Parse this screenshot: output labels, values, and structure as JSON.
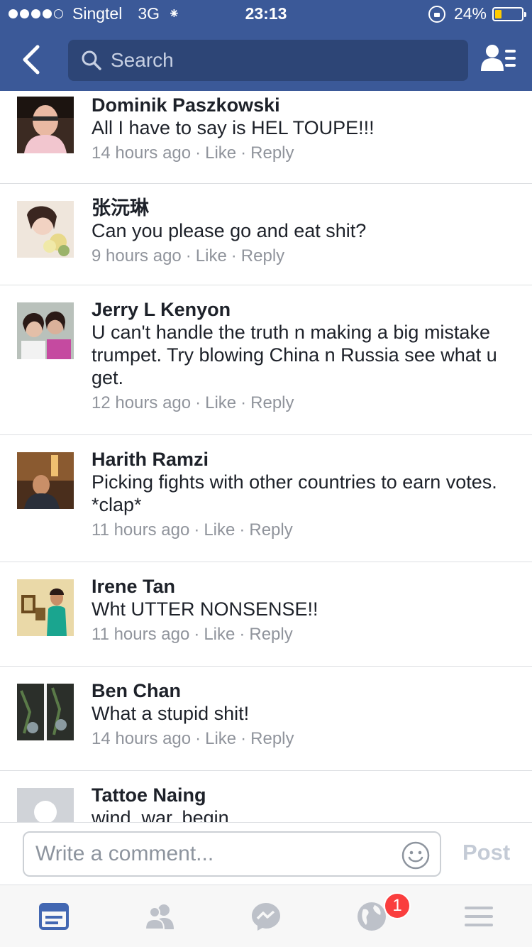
{
  "status_bar": {
    "carrier": "Singtel",
    "network": "3G",
    "time": "23:13",
    "battery": "24%",
    "battery_level": 0.24,
    "signal_bars": 4
  },
  "nav": {
    "search_placeholder": "Search"
  },
  "comments": [
    {
      "name": "Dominik Paszkowski",
      "text": "All I have to say is HEL TOUPE!!!",
      "time": "14 hours ago",
      "like": "Like",
      "reply": "Reply"
    },
    {
      "name": "张沅琳",
      "text": "Can you please go and eat shit?",
      "time": "9 hours ago",
      "like": "Like",
      "reply": "Reply"
    },
    {
      "name": "Jerry L Kenyon",
      "text": "U can't handle the truth n making a big mistake trumpet.  Try blowing China n Russia see what u get.",
      "time": "12 hours ago",
      "like": "Like",
      "reply": "Reply"
    },
    {
      "name": "Harith Ramzi",
      "text": "Picking fights with other countries to earn votes. *clap*",
      "time": "11 hours ago",
      "like": "Like",
      "reply": "Reply"
    },
    {
      "name": "Irene Tan",
      "text": "Wht UTTER NONSENSE!!",
      "time": "11 hours ago",
      "like": "Like",
      "reply": "Reply"
    },
    {
      "name": "Ben Chan",
      "text": "What a stupid shit!",
      "time": "14 hours ago",
      "like": "Like",
      "reply": "Reply"
    },
    {
      "name": "Tattoe Naing",
      "text": "wind, war, begin"
    }
  ],
  "composer": {
    "placeholder": "Write a comment...",
    "post_label": "Post"
  },
  "tabbar": {
    "notification_count": "1",
    "tabs": [
      "news-feed-icon",
      "friend-requests-icon",
      "messenger-icon",
      "notifications-globe-icon",
      "menu-icon"
    ]
  },
  "colors": {
    "header": "#3b5998",
    "search_bg": "#2d4576",
    "active_tab": "#4267b2",
    "badge": "#fa3e3e"
  }
}
